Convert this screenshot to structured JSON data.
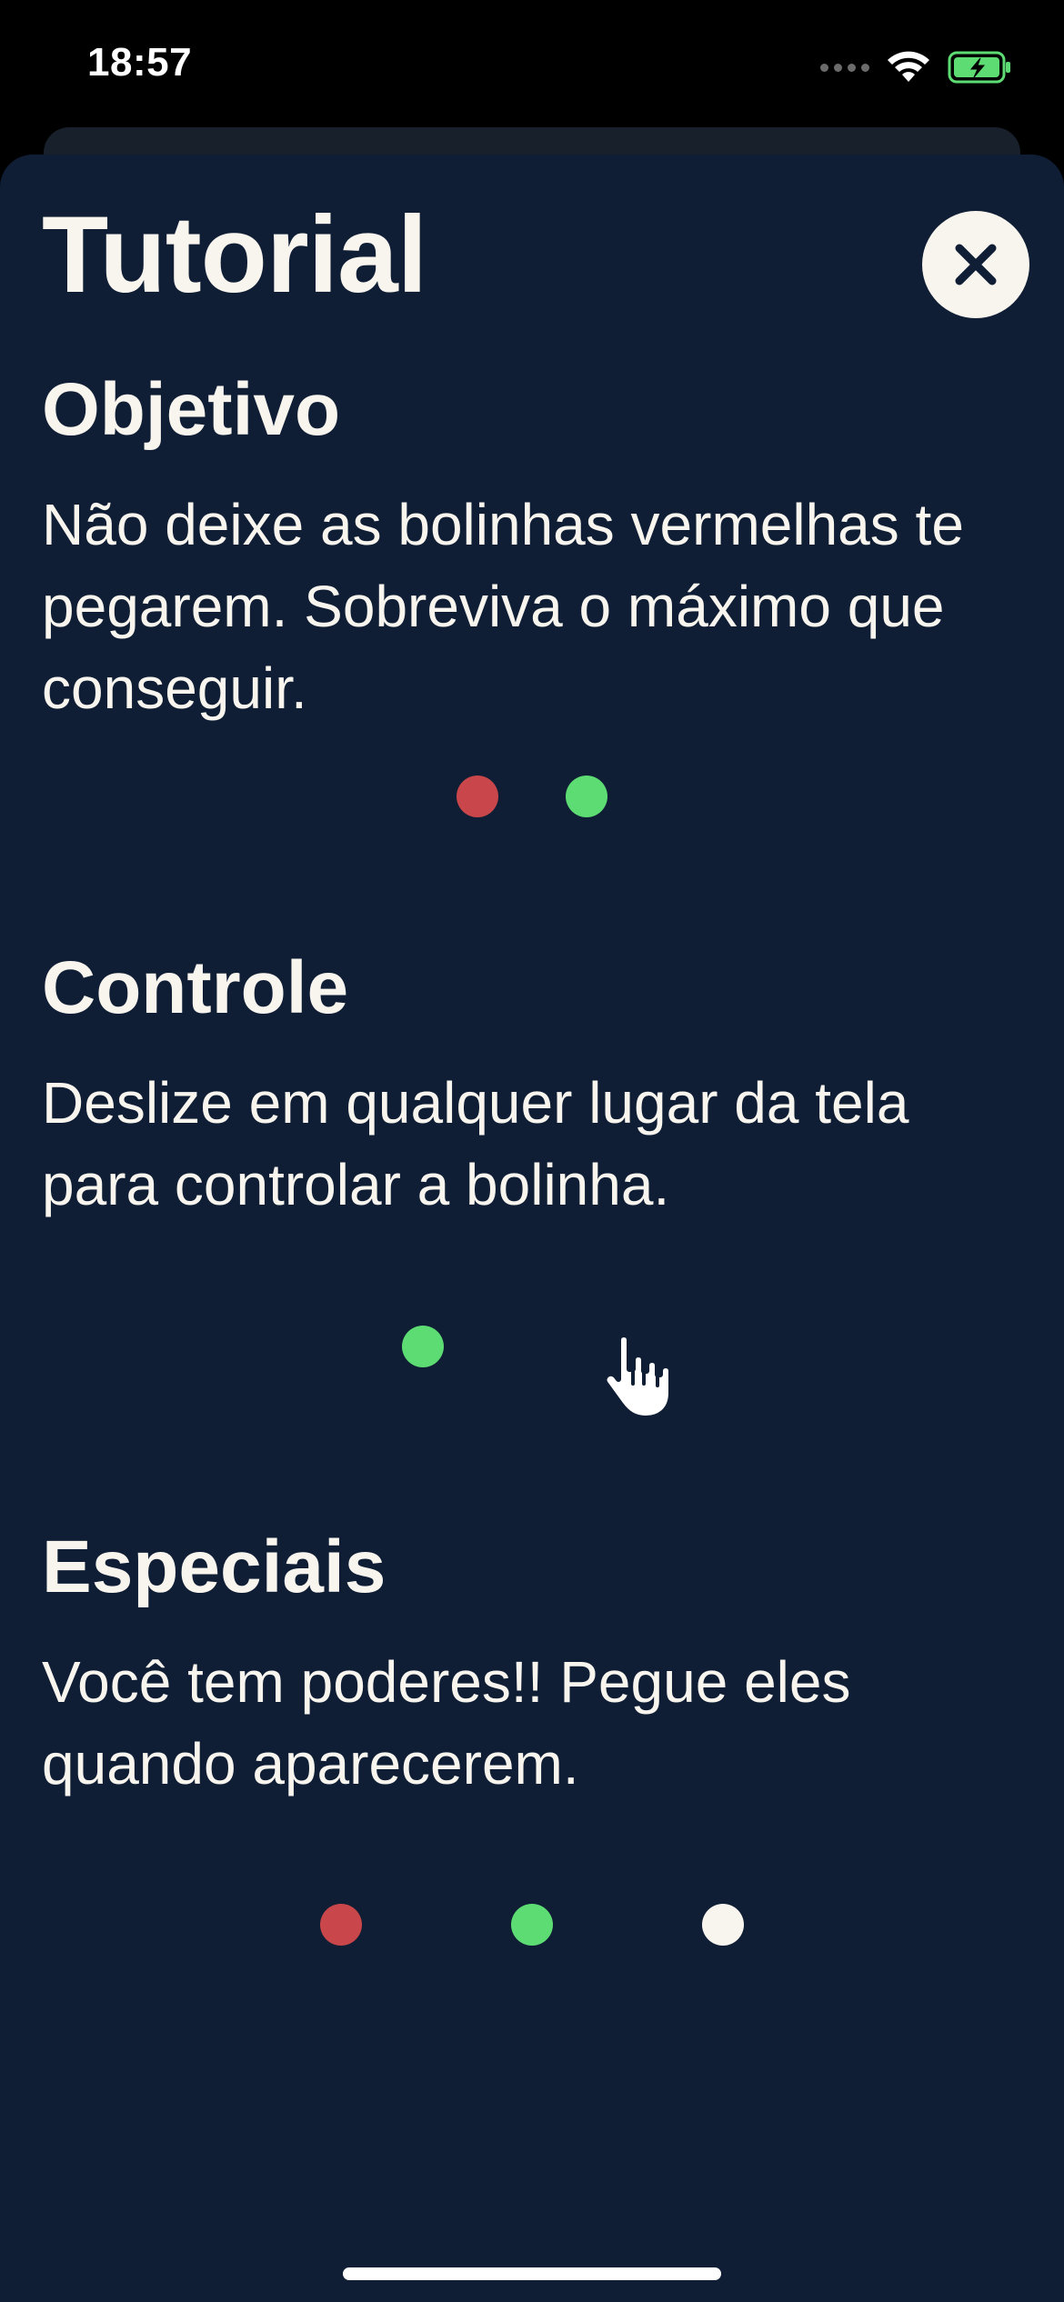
{
  "status_bar": {
    "time": "18:57",
    "icons": [
      "cellular-signal-icon",
      "wifi-icon",
      "battery-charging-icon"
    ],
    "battery_color": "#5edc74"
  },
  "sheet": {
    "title": "Tutorial",
    "close_icon": "close-icon",
    "background_color": "#0f1e35",
    "text_color": "#f8f4ee"
  },
  "sections": [
    {
      "title": "Objetivo",
      "body": "Não deixe as bolinhas vermelhas te pegarem. Sobreviva o máximo que conseguir.",
      "illustration": [
        "red-dot",
        "green-dot"
      ]
    },
    {
      "title": "Controle",
      "body": "Deslize em qualquer lugar da tela para controlar a bolinha.",
      "illustration": [
        "green-dot",
        "hand-swipe-icon"
      ]
    },
    {
      "title": "Especiais",
      "body": "Você tem poderes!! Pegue eles quando aparecerem.",
      "illustration": [
        "red-dot",
        "green-dot",
        "white-dot"
      ]
    }
  ],
  "colors": {
    "enemy_red": "#c9464a",
    "player_green": "#5edc74",
    "power_white": "#f8f4ee"
  }
}
